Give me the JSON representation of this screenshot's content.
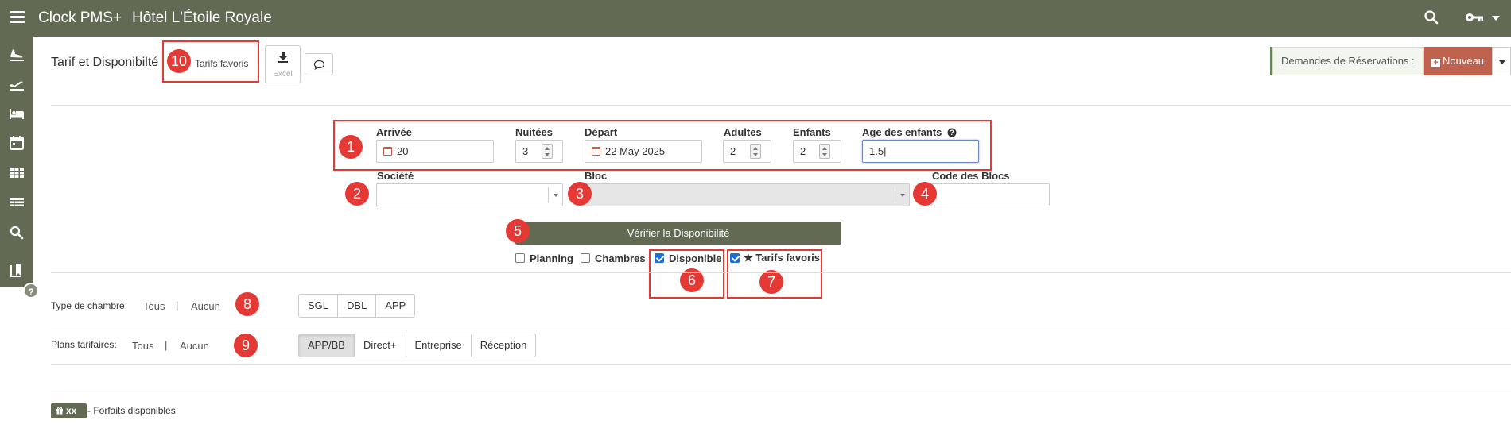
{
  "header": {
    "app_name": "Clock PMS+",
    "hotel_name": "Hôtel L'Étoile Royale",
    "icons": [
      "menu-icon",
      "search-icon",
      "key-icon",
      "caret-down-icon"
    ]
  },
  "sidebar": {
    "icons": [
      "plane-arrival-icon",
      "plane-departure-icon",
      "bed-icon",
      "calendar-icon",
      "grid-icon",
      "table-icon",
      "search-icon",
      "book-icon"
    ],
    "help_badge": "?"
  },
  "toolbar": {
    "page_title": "Tarif et Disponibilté",
    "favorites_label": "Tarifs favoris",
    "excel_label": "Excel"
  },
  "reservations": {
    "label": "Demandes de Réservations :",
    "new_label": "Nouveau"
  },
  "form": {
    "arrival": {
      "label": "Arrivée",
      "value": "20"
    },
    "nights": {
      "label": "Nuitées",
      "value": "3"
    },
    "departure": {
      "label": "Départ",
      "value": "22 May 2025"
    },
    "adults": {
      "label": "Adultes",
      "value": "2"
    },
    "children": {
      "label": "Enfants",
      "value": "2"
    },
    "children_age": {
      "label": "Age des enfants",
      "value": "1.5|"
    },
    "company": {
      "label": "Société",
      "value": ""
    },
    "block": {
      "label": "Bloc",
      "value": ""
    },
    "block_code": {
      "label": "Code des Blocs",
      "value": ""
    },
    "verify_button": "Vérifier la Disponibilité"
  },
  "options": {
    "planning": {
      "label": "Planning",
      "checked": false
    },
    "rooms": {
      "label": "Chambres",
      "checked": false
    },
    "available": {
      "label": "Disponible",
      "checked": true
    },
    "favorites": {
      "label": "★ Tarifs favoris",
      "checked": true
    }
  },
  "room_types": {
    "label": "Type de chambre:",
    "all": "Tous",
    "separator": "|",
    "none": "Aucun",
    "items": [
      "SGL",
      "DBL",
      "APP"
    ]
  },
  "rate_plans": {
    "label": "Plans tarifaires:",
    "all": "Tous",
    "separator": "|",
    "none": "Aucun",
    "items": [
      "APP/BB",
      "Direct+",
      "Entreprise",
      "Réception"
    ],
    "active": "APP/BB"
  },
  "footer": {
    "badge": "xx",
    "text": "- Forfaits disponibles"
  },
  "annotations": [
    "1",
    "2",
    "3",
    "4",
    "5",
    "6",
    "7",
    "8",
    "9",
    "10"
  ],
  "colors": {
    "header_bg": "#626a53",
    "annotation_red": "#e53935",
    "new_button": "#c0614d",
    "checkbox_blue": "#1a6ed8"
  }
}
